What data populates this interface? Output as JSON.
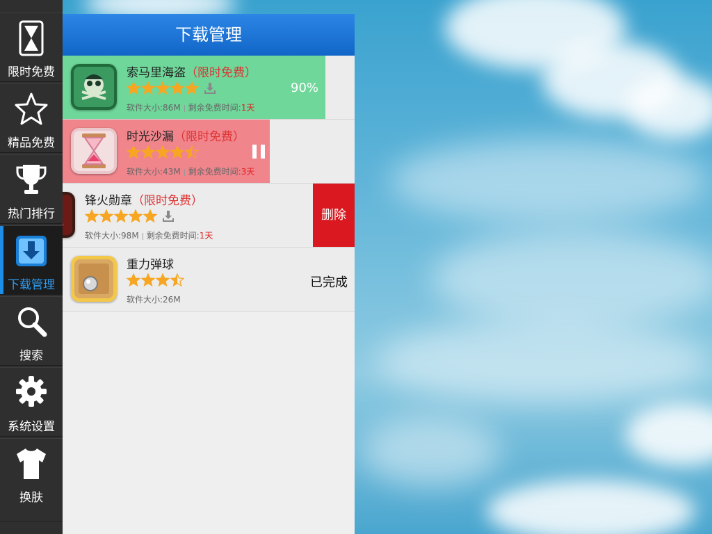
{
  "sidebar": {
    "items": [
      {
        "label": "限时免费",
        "icon": "hourglass-icon",
        "active": false
      },
      {
        "label": "精品免费",
        "icon": "star-icon",
        "active": false
      },
      {
        "label": "热门排行",
        "icon": "trophy-icon",
        "active": false
      },
      {
        "label": "下载管理",
        "icon": "download-icon",
        "active": true
      },
      {
        "label": "搜索",
        "icon": "search-icon",
        "active": false
      },
      {
        "label": "系统设置",
        "icon": "gear-icon",
        "active": false
      },
      {
        "label": "换肤",
        "icon": "tshirt-icon",
        "active": false
      }
    ]
  },
  "panel": {
    "title": "下载管理"
  },
  "downloads": [
    {
      "name": "索马里海盗",
      "tag": "（限时免费）",
      "rating": 5,
      "size_label": "软件大小:86M",
      "remaining_label": "剩余免费时间:",
      "remaining_value": "1天",
      "progress": 0.9,
      "progress_text": "90%",
      "state": "downloading",
      "progress_color": "#6fd79a"
    },
    {
      "name": "时光沙漏",
      "tag": "（限时免费）",
      "rating": 4.5,
      "size_label": "软件大小:43M",
      "remaining_label": "剩余免费时间:",
      "remaining_value": "3天",
      "progress": 0.71,
      "state": "paused",
      "progress_color": "#f1858c"
    },
    {
      "name": "锋火勋章",
      "tag": "（限时免费）",
      "rating": 5,
      "size_label": "软件大小:98M",
      "remaining_label": "剩余免费时间:",
      "remaining_value": "1天",
      "state": "swiped",
      "delete_label": "删除"
    },
    {
      "name": "重力弹球",
      "rating": 3.5,
      "size_label": "软件大小:26M",
      "state": "completed",
      "done_label": "已完成"
    }
  ],
  "colors": {
    "accent_blue": "#1f8ee8",
    "delete_red": "#d9191f",
    "star_gold": "#f6a623"
  }
}
